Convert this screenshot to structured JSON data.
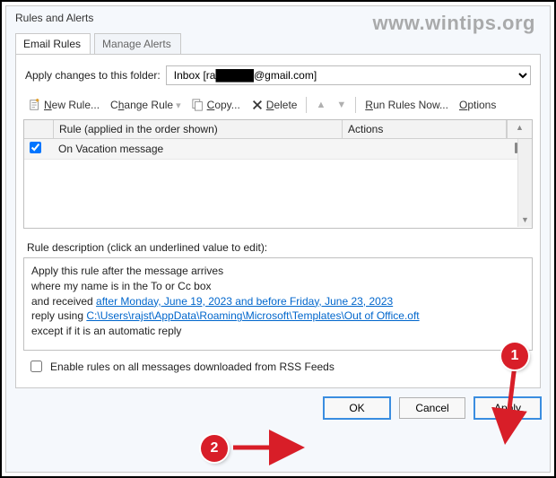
{
  "dialog_title": "Rules and Alerts",
  "watermark": "www.wintips.org",
  "tabs": {
    "email_rules": "Email Rules",
    "manage_alerts": "Manage Alerts"
  },
  "apply_changes_label": "Apply changes to this folder:",
  "folder_prefix": "Inbox [ra",
  "folder_suffix": "@gmail.com]",
  "toolbar": {
    "new_rule": "New Rule...",
    "change_rule": "Change Rule",
    "copy": "Copy...",
    "delete": "Delete",
    "run_rules": "Run Rules Now...",
    "options": "Options"
  },
  "table": {
    "col_rule": "Rule (applied in the order shown)",
    "col_actions": "Actions",
    "rows": [
      {
        "checked": true,
        "name": "On Vacation message"
      }
    ]
  },
  "description_label": "Rule description (click an underlined value to edit):",
  "desc": {
    "line1": "Apply this rule after the message arrives",
    "line2": "where my name is in the To or Cc box",
    "line3_prefix": "  and received ",
    "line3_link": "after Monday, June 19, 2023 and before Friday, June 23, 2023",
    "line4_prefix": "reply using ",
    "line4_link": "C:\\Users\\rajst\\AppData\\Roaming\\Microsoft\\Templates\\Out of Office.oft",
    "line5": "except if it is an automatic reply"
  },
  "rss_checkbox": "Enable rules on all messages downloaded from RSS Feeds",
  "buttons": {
    "ok": "OK",
    "cancel": "Cancel",
    "apply": "Apply"
  },
  "annotations": {
    "badge1": "1",
    "badge2": "2"
  }
}
